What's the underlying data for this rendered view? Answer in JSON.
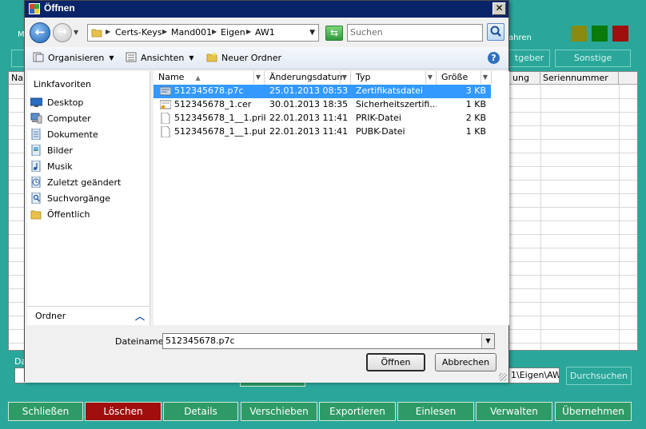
{
  "background_app": {
    "top_label_left": "M",
    "top_label_right": "ahren",
    "status_colors": [
      "#8a8a10",
      "#0a7a0a",
      "#a00e0e"
    ],
    "row1_buttons": [
      {
        "label": "tgeber"
      },
      {
        "label": "Sonstige"
      }
    ],
    "grid_columns": [
      {
        "label": "Na"
      },
      {
        "label": "ung"
      },
      {
        "label": "Seriennummer"
      }
    ],
    "label_da": "Da",
    "path_value": "1\\Eigen\\AW",
    "search_button": "Durchsuchen",
    "bottom_buttons": [
      {
        "label": "Schließen"
      },
      {
        "label": "Löschen"
      },
      {
        "label": "Details"
      },
      {
        "label": "Verschieben"
      },
      {
        "label": "Exportieren"
      },
      {
        "label": "Einlesen"
      },
      {
        "label": "Verwalten"
      },
      {
        "label": "Übernehmen"
      }
    ]
  },
  "dialog": {
    "title": "Öffnen",
    "close_glyph": "✕",
    "breadcrumb": [
      "Certs-Keys",
      "Mand001",
      "Eigen",
      "AW1"
    ],
    "search_placeholder": "Suchen",
    "toolbar": {
      "organize": "Organisieren",
      "views": "Ansichten",
      "new_folder": "Neuer Ordner",
      "help": "?"
    },
    "nav": {
      "heading": "Linkfavoriten",
      "items": [
        {
          "label": "Desktop",
          "icon": "desktop-icon"
        },
        {
          "label": "Computer",
          "icon": "computer-icon"
        },
        {
          "label": "Dokumente",
          "icon": "documents-icon"
        },
        {
          "label": "Bilder",
          "icon": "pictures-icon"
        },
        {
          "label": "Musik",
          "icon": "music-icon"
        },
        {
          "label": "Zuletzt geändert",
          "icon": "recent-icon"
        },
        {
          "label": "Suchvorgänge",
          "icon": "searches-icon"
        },
        {
          "label": "Öffentlich",
          "icon": "public-folder-icon"
        }
      ],
      "folders_label": "Ordner"
    },
    "columns": {
      "name": "Name",
      "date": "Änderungsdatum",
      "type": "Typ",
      "size": "Größe"
    },
    "files": [
      {
        "name": "512345678.p7c",
        "date": "25.01.2013 08:53",
        "type": "Zertifikatsdatei",
        "size": "3 KB",
        "selected": true,
        "icon": "certificate-file-icon"
      },
      {
        "name": "512345678_1.cer",
        "date": "30.01.2013 18:35",
        "type": "Sicherheitszertifi...",
        "size": "1 KB",
        "selected": false,
        "icon": "security-certificate-icon"
      },
      {
        "name": "512345678_1__1.prik",
        "date": "22.01.2013 11:41",
        "type": "PRIK-Datei",
        "size": "2 KB",
        "selected": false,
        "icon": "blank-file-icon"
      },
      {
        "name": "512345678_1__1.pubk",
        "date": "22.01.2013 11:41",
        "type": "PUBK-Datei",
        "size": "1 KB",
        "selected": false,
        "icon": "blank-file-icon"
      }
    ],
    "filename_label": "Dateiname:",
    "filename_value": "512345678.p7c",
    "open_button": "Öffnen",
    "cancel_button": "Abbrechen"
  }
}
